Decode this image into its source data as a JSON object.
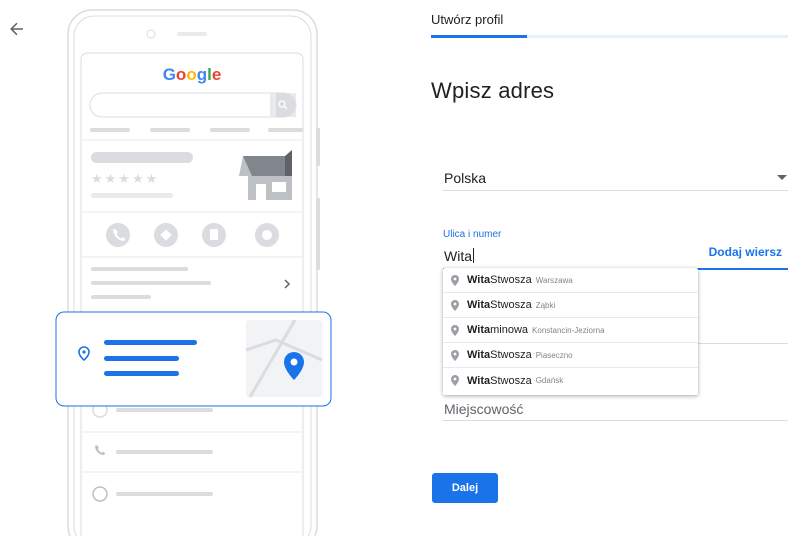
{
  "header": {
    "title": "Utwórz profil",
    "progress": 0.27
  },
  "main": {
    "heading": "Wpisz adres",
    "country": {
      "value": "Polska"
    },
    "street": {
      "label": "Ulica i numer",
      "value": "Wita",
      "add_row_label": "Dodaj wiersz"
    },
    "city": {
      "placeholder": "Miejscowość"
    },
    "suggestions": [
      {
        "match": "Wita",
        "rest": " Stwosza",
        "locality": "Warszawa"
      },
      {
        "match": "Wita",
        "rest": " Stwosza",
        "locality": "Ząbki"
      },
      {
        "match": "Wita",
        "rest": "minowa",
        "locality": "Konstancin-Jeziorna"
      },
      {
        "match": "Wita",
        "rest": " Stwosza",
        "locality": "Piaseczno"
      },
      {
        "match": "Wita",
        "rest": " Stwosza",
        "locality": "Gdańsk"
      }
    ],
    "next_label": "Dalej"
  },
  "illustration": {
    "brand": "Google",
    "rating_stars": "★★★★★"
  },
  "colors": {
    "accent": "#1a73e8",
    "track": "#e8f0fe"
  },
  "icons": [
    "arrow-back-icon",
    "dropdown-caret-icon",
    "place-pin-icon"
  ]
}
